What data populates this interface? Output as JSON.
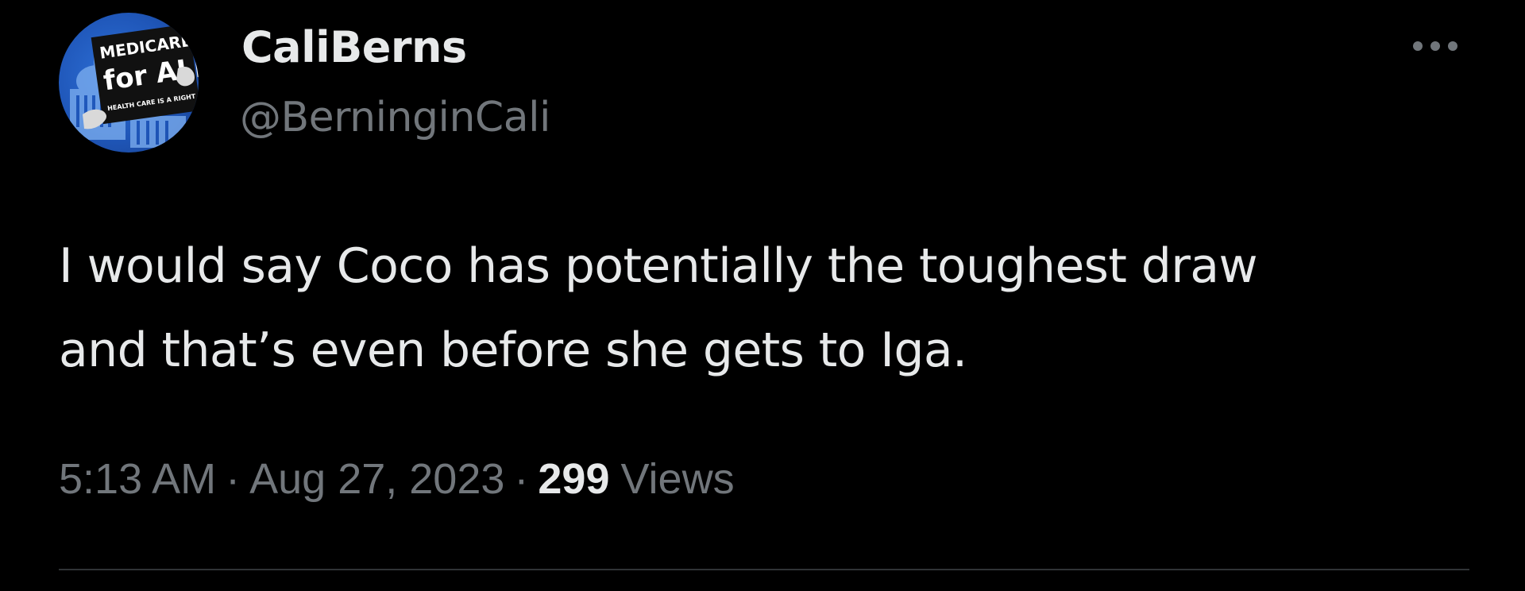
{
  "author": {
    "display_name": "CaliBerns",
    "handle": "@BerninginCali",
    "avatar": {
      "icon": "avatar-medicare-for-all-sign",
      "sign_line1": "MEDICARE",
      "sign_line2": "for ALL",
      "sign_line3": "HEALTH CARE IS A RIGHT"
    }
  },
  "menu": {
    "icon": "more-horizontal-icon"
  },
  "tweet": {
    "text": "I would say Coco has potentially the toughest draw\nand that’s even before she gets to Iga."
  },
  "meta": {
    "time": "5:13 AM",
    "separator": "·",
    "date": "Aug 27, 2023",
    "views_count": "299",
    "views_label": "Views"
  },
  "colors": {
    "background": "#000000",
    "primary_text": "#e7e9ea",
    "secondary_text": "#71767b",
    "divider": "#2f3336",
    "avatar_blue": "#1f56b8"
  }
}
